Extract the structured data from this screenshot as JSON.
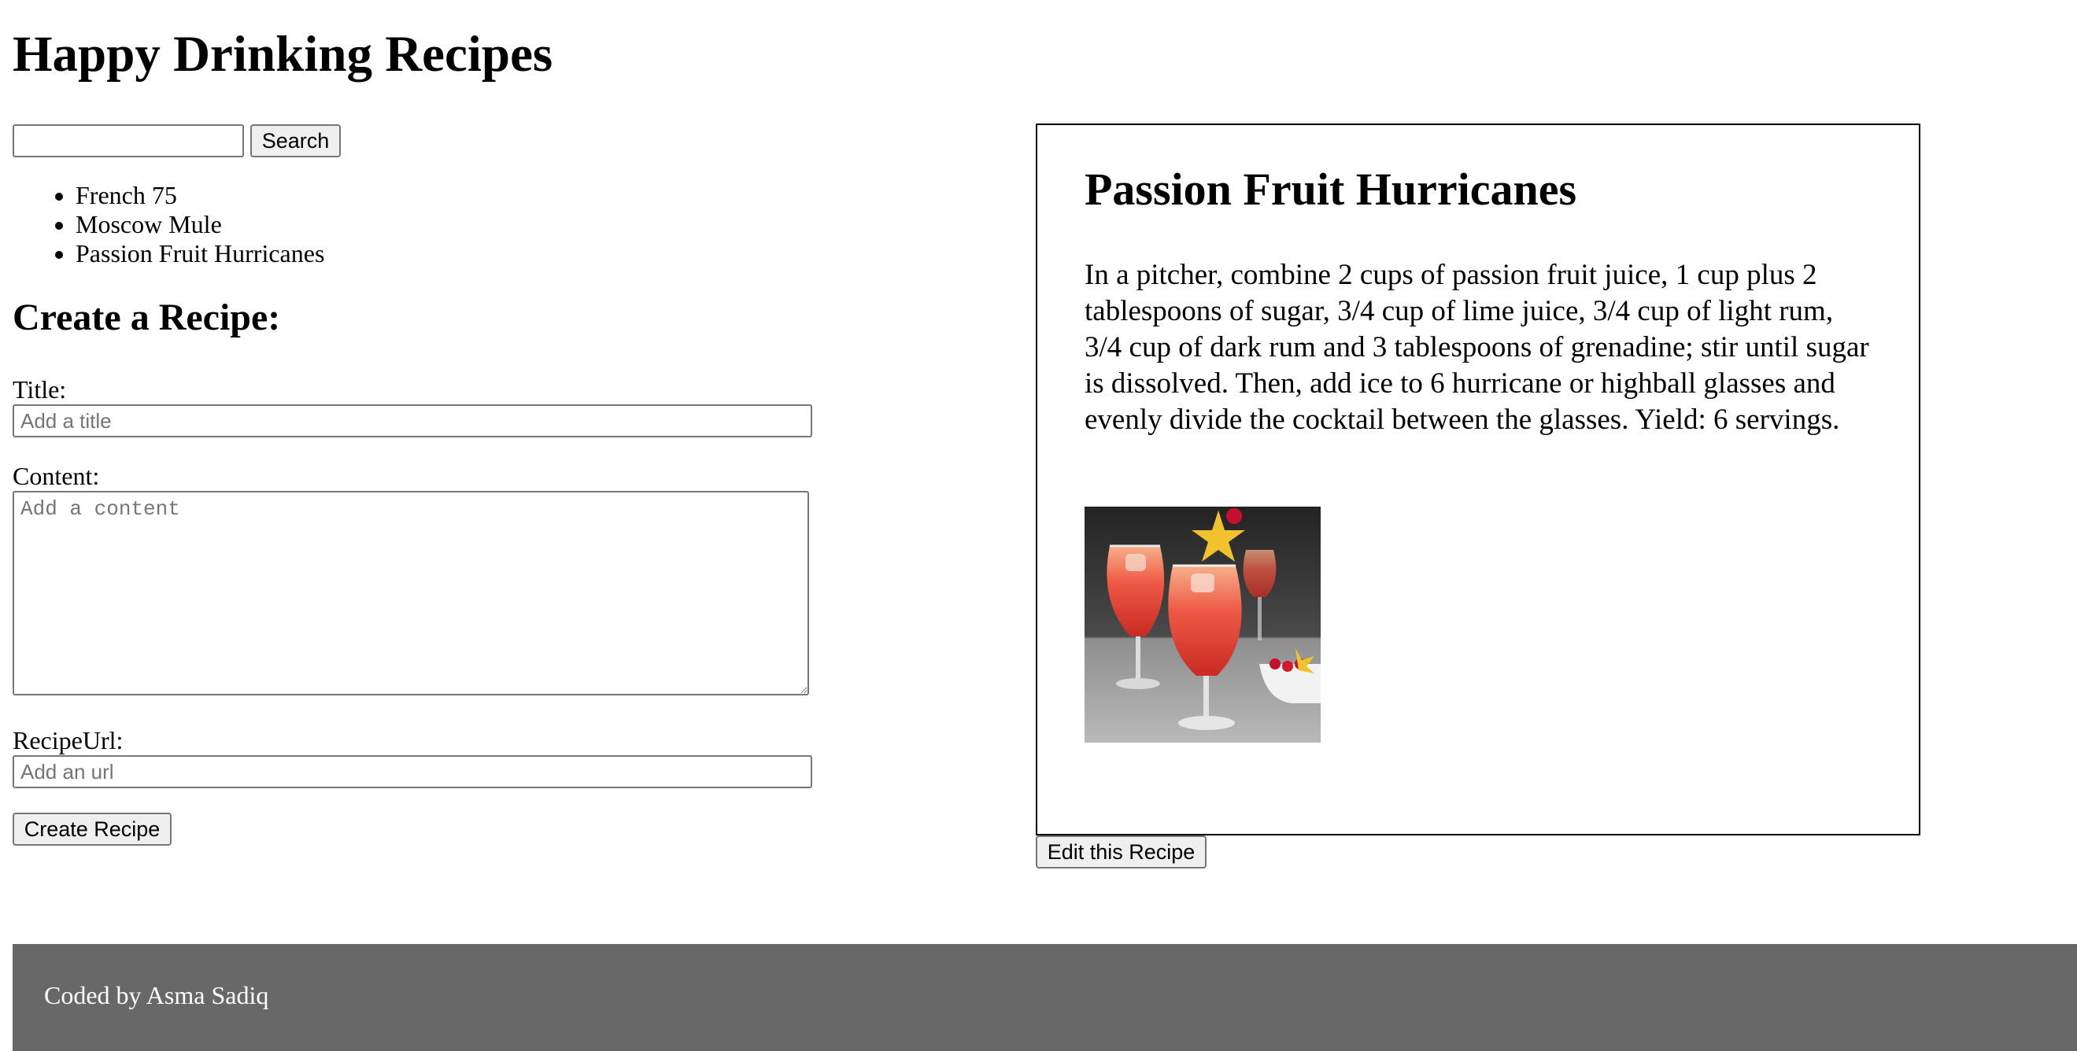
{
  "app": {
    "title": "Happy Drinking Recipes"
  },
  "search": {
    "value": "",
    "button_label": "Search"
  },
  "recipes": [
    {
      "label": "French 75"
    },
    {
      "label": "Moscow Mule"
    },
    {
      "label": "Passion Fruit Hurricanes"
    }
  ],
  "create_form": {
    "heading": "Create a Recipe:",
    "title_label": "Title:",
    "title_placeholder": "Add a title",
    "content_label": "Content:",
    "content_placeholder": "Add a content",
    "url_label": "RecipeUrl:",
    "url_placeholder": "Add an url",
    "submit_label": "Create Recipe"
  },
  "selected_recipe": {
    "title": "Passion Fruit Hurricanes",
    "content": "In a pitcher, combine 2 cups of passion fruit juice, 1 cup plus 2 tablespoons of sugar, 3/4 cup of lime juice, 3/4 cup of light rum, 3/4 cup of dark rum and 3 tablespoons of grenadine; stir until sugar is dissolved. Then, add ice to 6 hurricane or highball glasses and evenly divide the cocktail between the glasses. Yield: 6 servings.",
    "edit_label": "Edit this Recipe"
  },
  "footer": {
    "text": "Coded by Asma Sadiq"
  },
  "colors": {
    "footer_bg": "#686868",
    "drink": "#e2463a",
    "garnish": "#f2c12e"
  }
}
